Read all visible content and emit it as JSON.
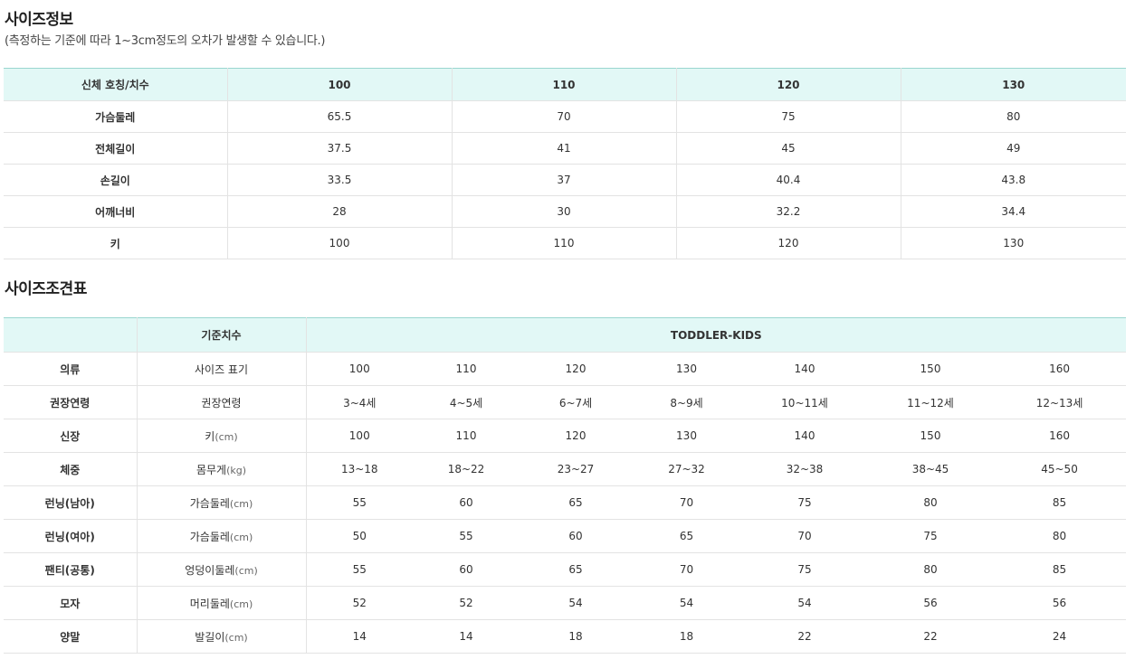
{
  "size_info": {
    "title": "사이즈정보",
    "note": "(측정하는 기준에 따라 1~3cm정도의 오차가 발생할 수 있습니다.)",
    "header": [
      "신체 호칭/치수",
      "100",
      "110",
      "120",
      "130"
    ],
    "rows": [
      {
        "label": "가슴둘레",
        "values": [
          "65.5",
          "70",
          "75",
          "80"
        ]
      },
      {
        "label": "전체길이",
        "values": [
          "37.5",
          "41",
          "45",
          "49"
        ]
      },
      {
        "label": "손길이",
        "values": [
          "33.5",
          "37",
          "40.4",
          "43.8"
        ]
      },
      {
        "label": "어깨너비",
        "values": [
          "28",
          "30",
          "32.2",
          "34.4"
        ]
      },
      {
        "label": "키",
        "values": [
          "100",
          "110",
          "120",
          "130"
        ]
      }
    ]
  },
  "size_chart": {
    "title": "사이즈조견표",
    "header": {
      "blank": "",
      "standard": "기준치수",
      "group": "TODDLER-KIDS"
    },
    "rows": [
      {
        "label": "의류",
        "standard": "사이즈 표기",
        "unit": "",
        "values": [
          "100",
          "110",
          "120",
          "130",
          "140",
          "150",
          "160"
        ]
      },
      {
        "label": "권장연령",
        "standard": "권장연령",
        "unit": "",
        "values": [
          "3~4세",
          "4~5세",
          "6~7세",
          "8~9세",
          "10~11세",
          "11~12세",
          "12~13세"
        ]
      },
      {
        "label": "신장",
        "standard": "키",
        "unit": "(cm)",
        "values": [
          "100",
          "110",
          "120",
          "130",
          "140",
          "150",
          "160"
        ]
      },
      {
        "label": "체중",
        "standard": "몸무게",
        "unit": "(kg)",
        "values": [
          "13~18",
          "18~22",
          "23~27",
          "27~32",
          "32~38",
          "38~45",
          "45~50"
        ]
      },
      {
        "label": "런닝(남아)",
        "standard": "가슴둘레",
        "unit": "(cm)",
        "values": [
          "55",
          "60",
          "65",
          "70",
          "75",
          "80",
          "85"
        ]
      },
      {
        "label": "런닝(여아)",
        "standard": "가슴둘레",
        "unit": "(cm)",
        "values": [
          "50",
          "55",
          "60",
          "65",
          "70",
          "75",
          "80"
        ]
      },
      {
        "label": "팬티(공통)",
        "standard": "엉덩이둘레",
        "unit": "(cm)",
        "values": [
          "55",
          "60",
          "65",
          "70",
          "75",
          "80",
          "85"
        ]
      },
      {
        "label": "모자",
        "standard": "머리둘레",
        "unit": "(cm)",
        "values": [
          "52",
          "52",
          "54",
          "54",
          "54",
          "56",
          "56"
        ]
      },
      {
        "label": "양말",
        "standard": "발길이",
        "unit": "(cm)",
        "values": [
          "14",
          "14",
          "18",
          "18",
          "22",
          "22",
          "24"
        ]
      }
    ]
  },
  "colors": {
    "header_bg": "#e2f8f6",
    "top_border": "#9ad6cf",
    "row_border": "#e3e3e3"
  }
}
